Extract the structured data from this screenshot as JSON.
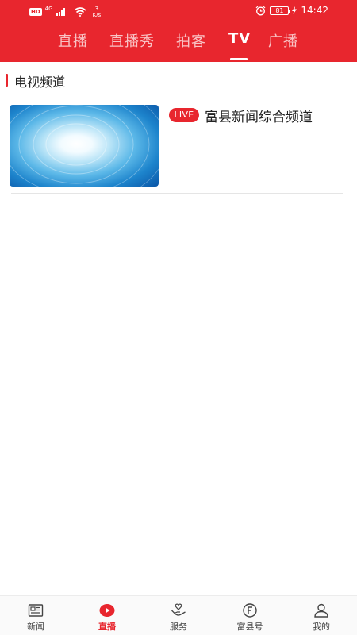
{
  "status_bar": {
    "hd": "HD",
    "net_type": "4G",
    "speed_value": "3",
    "speed_unit": "K/s",
    "battery": "81",
    "time": "14:42"
  },
  "tabs": [
    {
      "label": "直播",
      "active": false
    },
    {
      "label": "直播秀",
      "active": false
    },
    {
      "label": "拍客",
      "active": false
    },
    {
      "label": "TV",
      "active": true
    },
    {
      "label": "广播",
      "active": false
    }
  ],
  "section": {
    "title": "电视频道"
  },
  "channels": [
    {
      "badge": "LIVE",
      "name": "富县新闻综合频道"
    }
  ],
  "bottom_nav": [
    {
      "label": "新闻",
      "icon": "newspaper-icon",
      "active": false
    },
    {
      "label": "直播",
      "icon": "play-icon",
      "active": true
    },
    {
      "label": "服务",
      "icon": "service-icon",
      "active": false
    },
    {
      "label": "富县号",
      "icon": "f-circle-icon",
      "active": false
    },
    {
      "label": "我的",
      "icon": "user-icon",
      "active": false
    }
  ],
  "colors": {
    "brand_red": "#e8262e",
    "text_dark": "#222222",
    "divider": "#e5e5e5"
  }
}
